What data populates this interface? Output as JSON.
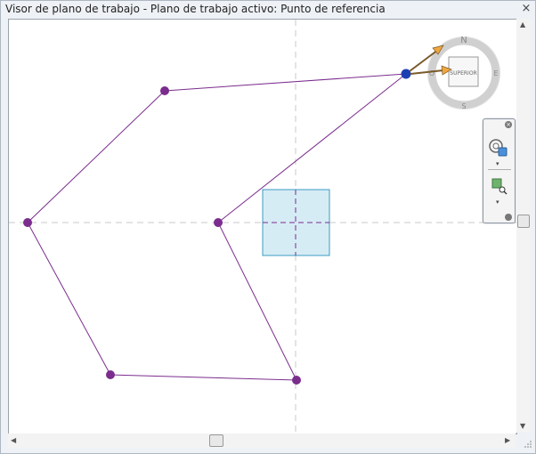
{
  "window": {
    "title": "Visor de plano de trabajo - Plano de trabajo activo: Punto de referencia",
    "close_glyph": "×"
  },
  "viewcube": {
    "face_label": "SUPERIOR",
    "compass": {
      "n": "N",
      "e": "E",
      "s": "S",
      "w": "O"
    }
  },
  "nav_bar": {
    "close_glyph": "×",
    "tools": [
      "steering-wheel-icon",
      "zoom-window-icon"
    ],
    "dropdown_glyph": "▾"
  },
  "scrollbars": {
    "up": "▲",
    "down": "▼",
    "left": "◀",
    "right": "▶"
  },
  "colors": {
    "path": "#7b2d8e",
    "selected_point": "#1c3fb3",
    "reference_plane_fill": "#d6ecf5",
    "reference_plane_stroke": "#3a9bc2",
    "guide": "#c8c8c8"
  }
}
